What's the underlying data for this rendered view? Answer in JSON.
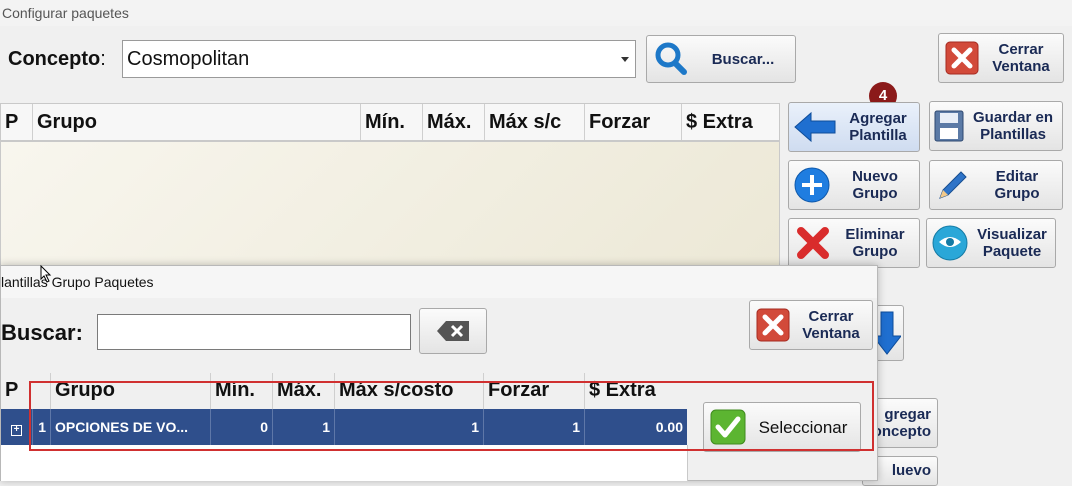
{
  "window": {
    "title": "Configurar paquetes"
  },
  "concepto": {
    "label": "Concepto",
    "colon": ":",
    "value": "Cosmopolitan"
  },
  "buttons": {
    "buscar": "Buscar...",
    "cerrar_l1": "Cerrar",
    "cerrar_l2": "Ventana",
    "agregar_l1": "Agregar",
    "agregar_l2": "Plantilla",
    "guardar_l1": "Guardar en",
    "guardar_l2": "Plantillas",
    "nuevo_l1": "Nuevo",
    "nuevo_l2": "Grupo",
    "editar_l1": "Editar",
    "editar_l2": "Grupo",
    "eliminar_l1": "Eliminar",
    "eliminar_l2": "Grupo",
    "visualizar_l1": "Visualizar",
    "visualizar_l2": "Paquete",
    "agregar_concepto_l1": "gregar",
    "agregar_concepto_l2": "oncepto",
    "nuevo_partial": "luevo"
  },
  "badge": "4",
  "main_grid": {
    "columns": [
      "P",
      "Grupo",
      "Mín.",
      "Máx.",
      "Máx s/c",
      "Forzar",
      "$ Extra"
    ]
  },
  "dialog": {
    "title": "lantillas Grupo Paquetes",
    "search_label": "Buscar:",
    "search_value": "",
    "cerrar_l1": "Cerrar",
    "cerrar_l2": "Ventana",
    "seleccionar": "Seleccionar",
    "columns": [
      "P",
      "Grupo",
      "Mín.",
      "Máx.",
      "Máx s/costo",
      "Forzar",
      "$ Extra"
    ],
    "row": {
      "expand": "+",
      "p": "1",
      "grupo": "OPCIONES DE VO...",
      "min": "0",
      "max": "1",
      "max_sc": "1",
      "forzar": "1",
      "extra": "0.00"
    }
  },
  "colors": {
    "accent": "#2f4f8c",
    "highlight": "#d03030",
    "badge": "#8b1a1a"
  }
}
